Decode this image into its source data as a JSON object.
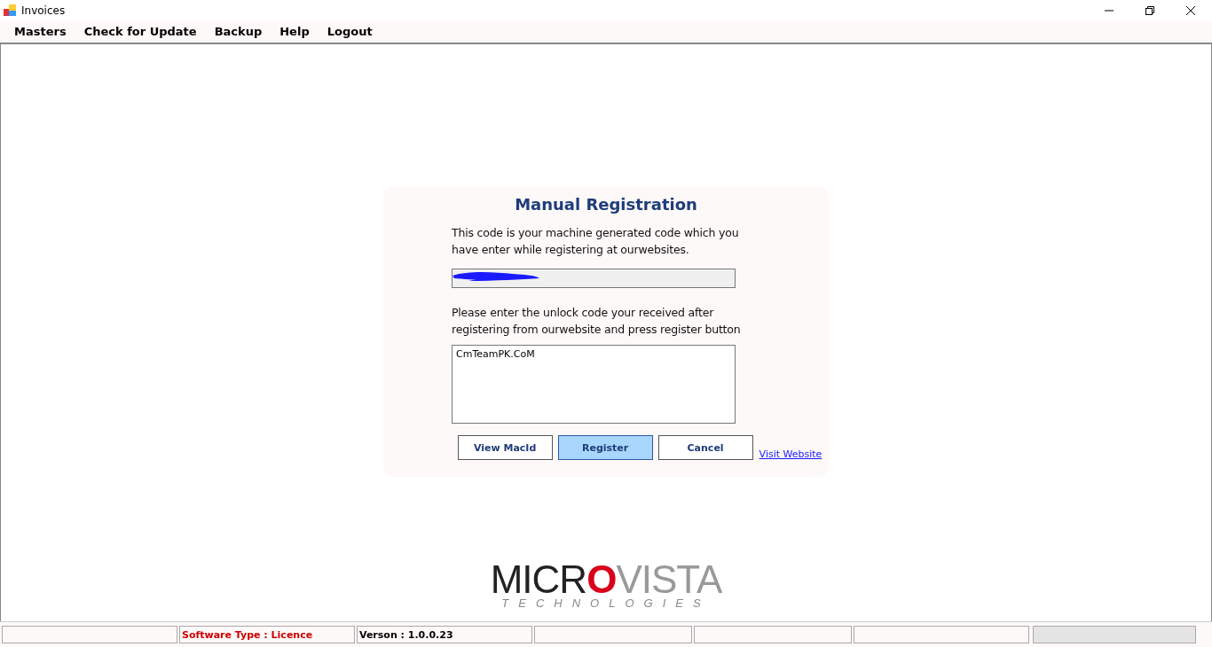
{
  "window": {
    "title": "Invoices"
  },
  "menu": [
    "Masters",
    "Check for Update",
    "Backup",
    "Help",
    "Logout"
  ],
  "dialog": {
    "title": "Manual Registration",
    "machine_code_text": "This code is your machine generated code which you have enter while registering at ourwebsites.",
    "unlock_text": "Please enter the unlock code your received after registering from ourwebsite and press register button",
    "unlock_code": "CmTeamPK.CoM",
    "buttons": [
      {
        "label": "View MacId",
        "selected": false
      },
      {
        "label": "Register",
        "selected": true
      },
      {
        "label": "Cancel",
        "selected": false
      }
    ],
    "link": "Visit Website"
  },
  "logo": {
    "name_start": "MICR",
    "name_accent": "O",
    "name_end": "VISTA",
    "tagline": "TECHNOLOGIES"
  },
  "status_bar": {
    "software_type": "Software Type : Licence",
    "version": "Verson : 1.0.0.23",
    "progress": {
      "level": 0
    }
  }
}
